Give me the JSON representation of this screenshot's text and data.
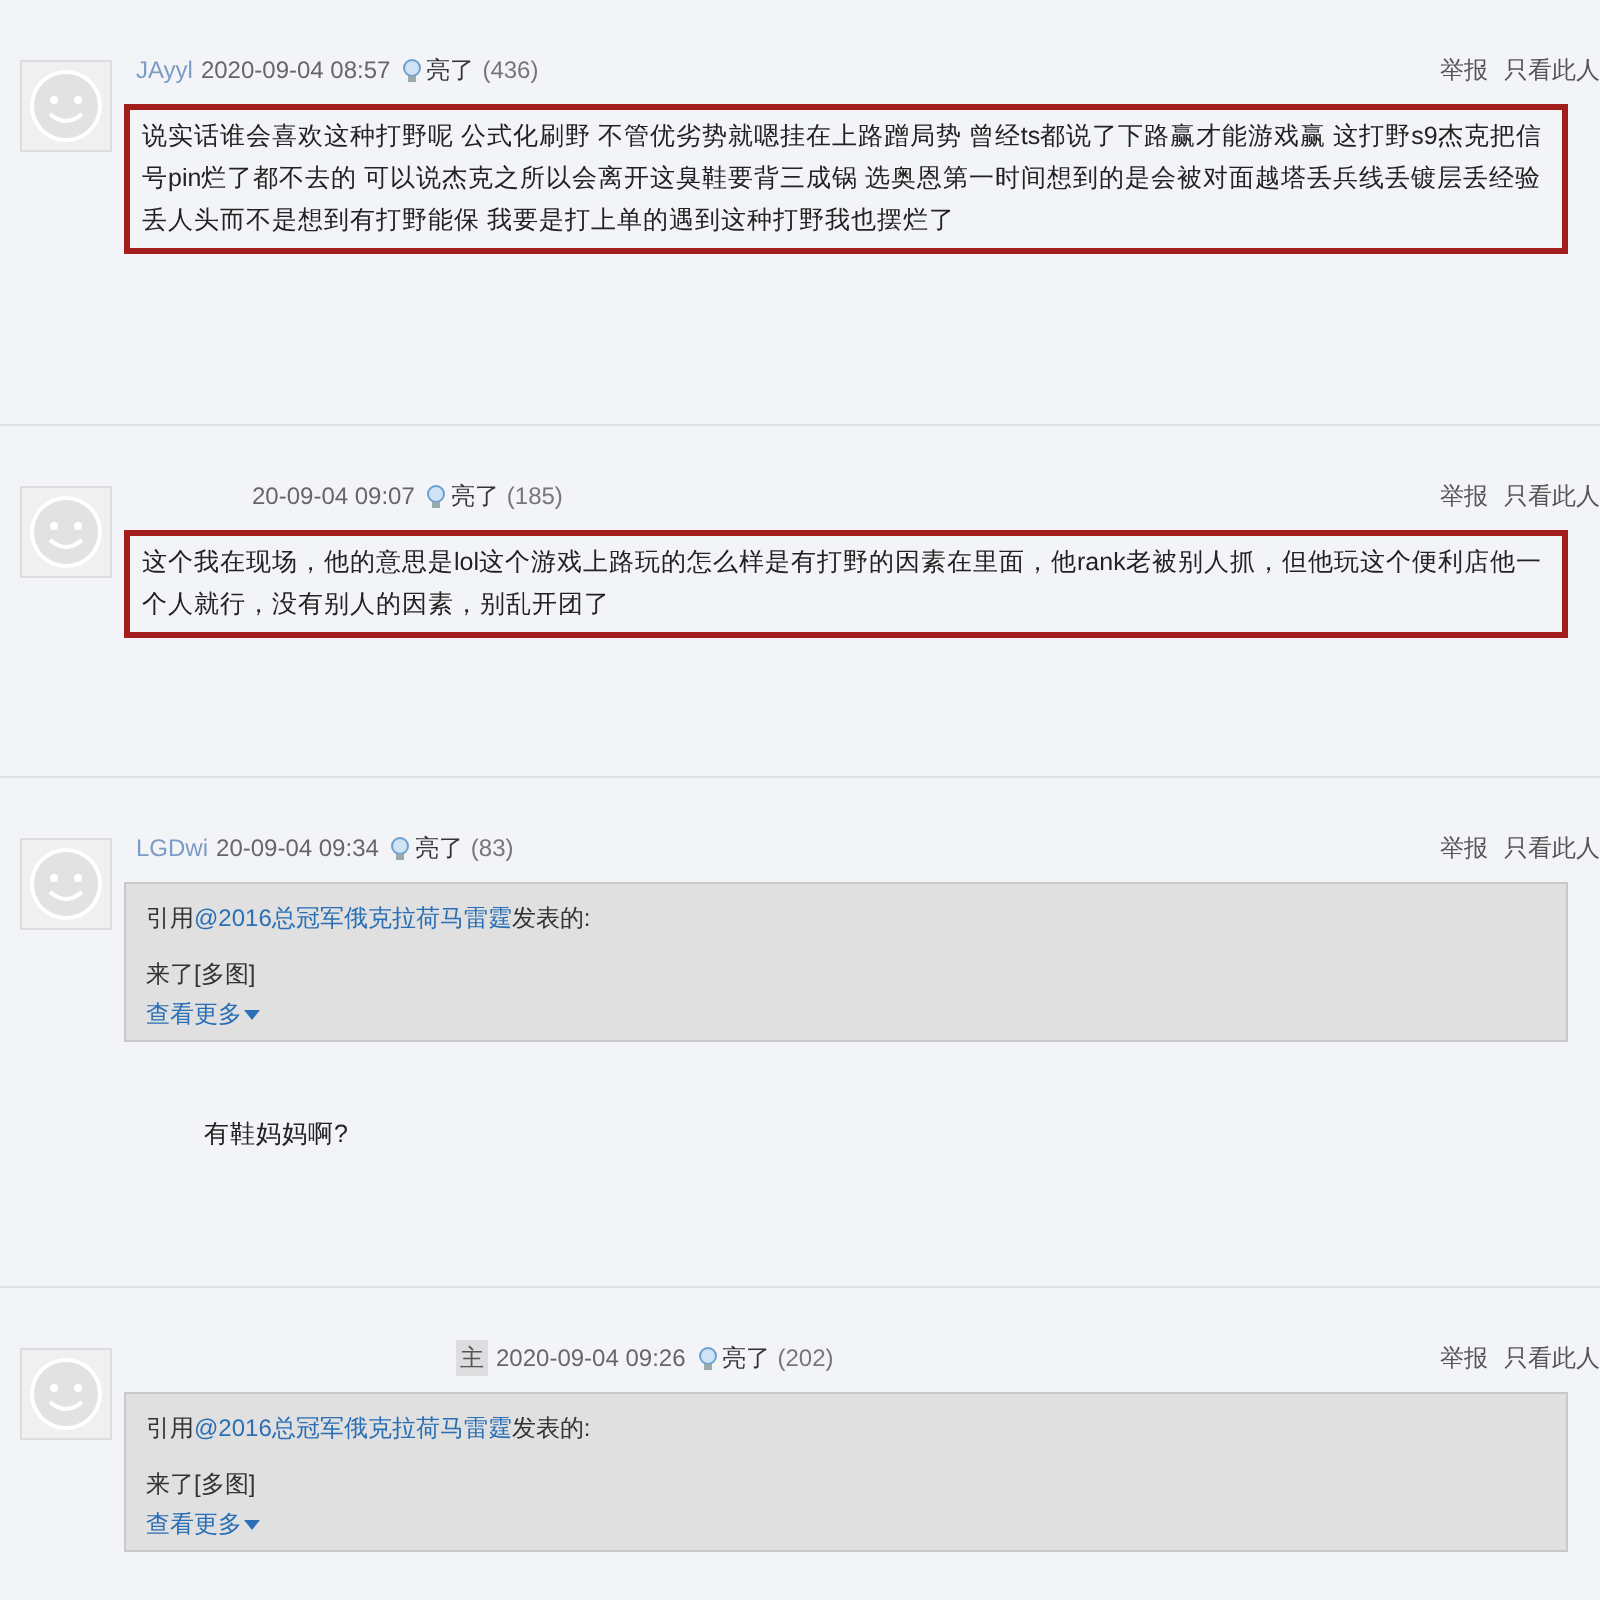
{
  "posts": [
    {
      "user": "JAyyl",
      "time": "2020-09-04 08:57",
      "likes_label": "亮了",
      "likes": "(436)",
      "actions": [
        "举报",
        "只看此人"
      ],
      "highlighted": true,
      "body": "说实话谁会喜欢这种打野呢 公式化刷野 不管优劣势就嗯挂在上路蹭局势 曾经ts都说了下路赢才能游戏赢 这打野s9杰克把信号pin烂了都不去的 可以说杰克之所以会离开这臭鞋要背三成锅 选奥恩第一时间想到的是会被对面越塔丢兵线丢镀层丢经验丢人头而不是想到有打野能保 我要是打上单的遇到这种打野我也摆烂了"
    },
    {
      "time": "20-09-04 09:07",
      "likes_label": "亮了",
      "likes": "(185)",
      "actions": [
        "举报",
        "只看此人"
      ],
      "highlighted": true,
      "body": "这个我在现场，他的意思是lol这个游戏上路玩的怎么样是有打野的因素在里面，他rank老被别人抓，但他玩这个便利店他一个人就行，没有别人的因素，别乱开团了"
    },
    {
      "user": "LGDwi",
      "time": "20-09-04 09:34",
      "likes_label": "亮了",
      "likes": "(83)",
      "actions": [
        "举报",
        "只看此人"
      ],
      "highlighted": false,
      "quote": {
        "prefix": "引用 ",
        "author": "@2016总冠军俄克拉荷马雷霆",
        "suffix": " 发表的:",
        "text": "来了[多图]",
        "more": "查看更多"
      },
      "body": "有鞋妈妈啊?"
    },
    {
      "tag": "主",
      "time": "2020-09-04 09:26",
      "likes_label": "亮了",
      "likes": "(202)",
      "actions": [
        "举报",
        "只看此人"
      ],
      "quote": {
        "prefix": "引用 ",
        "author": "@2016总冠军俄克拉荷马雷霆",
        "suffix": " 发表的:",
        "text": "来了[多图]",
        "more": "查看更多"
      }
    }
  ]
}
